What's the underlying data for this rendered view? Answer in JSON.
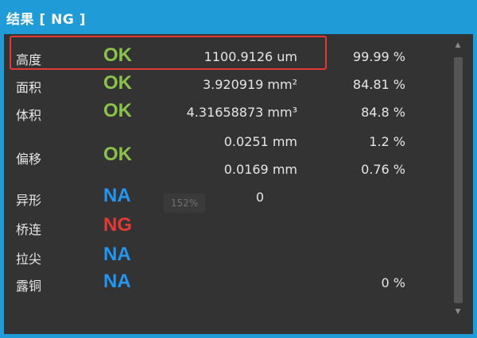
{
  "window": {
    "title": "结果 [ NG ]"
  },
  "rows": [
    {
      "label": "高度",
      "status": "OK",
      "value": "1100.9126 um",
      "pct": "99.99 %"
    },
    {
      "label": "面积",
      "status": "OK",
      "value": "3.920919 mm²",
      "pct": "84.81 %"
    },
    {
      "label": "体积",
      "status": "OK",
      "value": "4.31658873 mm³",
      "pct": "84.8 %"
    },
    {
      "label": "偏移",
      "status": "OK",
      "value1": "0.0251 mm",
      "pct1": "1.2 %",
      "value2": "0.0169 mm",
      "pct2": "0.76 %"
    },
    {
      "label": "异形",
      "status": "NA",
      "value": "0",
      "zoom": "152%"
    },
    {
      "label": "桥连",
      "status": "NG"
    },
    {
      "label": "拉尖",
      "status": "NA"
    },
    {
      "label": "露铜",
      "status": "NA",
      "pct": "0 %"
    }
  ],
  "colors": {
    "ok": "#8bc34a",
    "na": "#2196f3",
    "ng": "#e53935",
    "accent": "#1f9bd8"
  }
}
